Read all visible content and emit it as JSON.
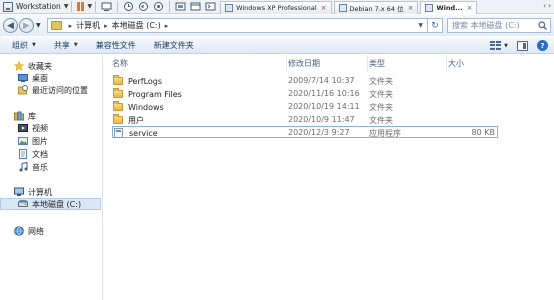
{
  "vmware": {
    "app_label": "Workstation",
    "tabs": [
      {
        "label": "Windows XP Professional"
      },
      {
        "label": "Debian 7.x 64 位"
      },
      {
        "label": "Wind..."
      }
    ]
  },
  "address": {
    "crumbs": [
      "计算机",
      "本地磁盘 (C:)"
    ],
    "search_placeholder": "搜索 本地磁盘 (C:)"
  },
  "commands": {
    "organize": "组织",
    "share": "共享",
    "burn": "兼容性文件",
    "new_folder": "新建文件夹"
  },
  "nav": {
    "favorites": "收藏夹",
    "desktop": "桌面",
    "recent": "最近访问的位置",
    "libraries": "库",
    "videos": "视频",
    "pictures": "图片",
    "documents": "文档",
    "music": "音乐",
    "computer": "计算机",
    "local_disk": "本地磁盘 (C:)",
    "network": "网络"
  },
  "columns": {
    "name": "名称",
    "modified": "修改日期",
    "type": "类型",
    "size": "大小"
  },
  "files": [
    {
      "name": "PerfLogs",
      "modified": "2009/7/14 10:37",
      "type": "文件夹",
      "size": "",
      "kind": "folder"
    },
    {
      "name": "Program Files",
      "modified": "2020/11/16 10:16",
      "type": "文件夹",
      "size": "",
      "kind": "folder"
    },
    {
      "name": "Windows",
      "modified": "2020/10/19 14:11",
      "type": "文件夹",
      "size": "",
      "kind": "folder"
    },
    {
      "name": "用户",
      "modified": "2020/10/9 11:47",
      "type": "文件夹",
      "size": "",
      "kind": "folder"
    },
    {
      "name": "service",
      "modified": "2020/12/3 9:27",
      "type": "应用程序",
      "size": "80 KB",
      "kind": "exe"
    }
  ]
}
